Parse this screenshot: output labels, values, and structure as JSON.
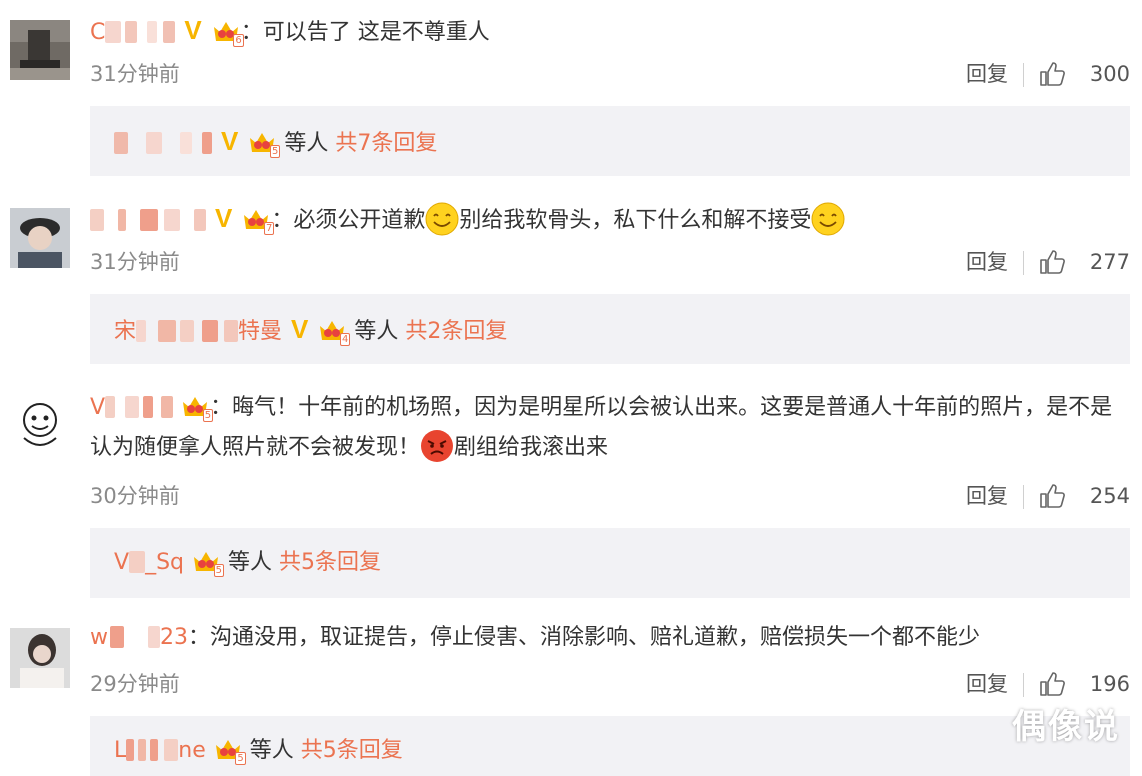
{
  "comments": [
    {
      "name_visible": "C",
      "text": "可以告了  这是不尊重人",
      "time": "31分钟前",
      "reply_label": "回复",
      "likes": "300",
      "crown_level": "6",
      "sub": {
        "name_visible": "",
        "crown_level": "5",
        "others": "等人",
        "total": "共7条回复"
      }
    },
    {
      "name_visible": "",
      "text_a": "必须公开道歉",
      "text_b": "别给我软骨头，私下什么和解不接受",
      "time": "31分钟前",
      "reply_label": "回复",
      "likes": "277",
      "crown_level": "7",
      "sub": {
        "name_visible_start": "宋",
        "name_visible_end": "特曼",
        "crown_level": "4",
        "others": "等人",
        "total": "共2条回复"
      }
    },
    {
      "name_visible": "V",
      "text_a": "晦气！十年前的机场照，因为是明星所以会被认出来。这要是普通人十年前的照片，是不是认为随便拿人照片就不会被发现！",
      "text_b": "剧组给我滚出来",
      "time": "30分钟前",
      "reply_label": "回复",
      "likes": "254",
      "crown_level": "5",
      "sub": {
        "name_visible_start": "V",
        "name_visible_end": "_Sq",
        "crown_level": "5",
        "others": "等人",
        "total": "共5条回复"
      }
    },
    {
      "name_visible_start": "w",
      "name_visible_end": "23",
      "text": "沟通没用，取证提告，停止侵害、消除影响、赔礼道歉，赔偿损失一个都不能少",
      "time": "29分钟前",
      "reply_label": "回复",
      "likes": "196",
      "sub": {
        "name_visible_start": "L",
        "name_visible_end": "ne",
        "crown_level": "5",
        "others": "等人",
        "total": "共5条回复"
      }
    }
  ],
  "colon": "：",
  "watermark": "偶像说",
  "colors": {
    "username": "#eb7350",
    "vip_badge": "#f7b500",
    "subbox_bg": "#f2f2f5",
    "meta_text": "#8a8a8a"
  },
  "icons": {
    "like": "thumbs-up-icon",
    "crown": "member-crown-icon",
    "vip": "v-verified-icon",
    "smile": "smile-emoji-icon",
    "angry": "angry-emoji-icon"
  }
}
